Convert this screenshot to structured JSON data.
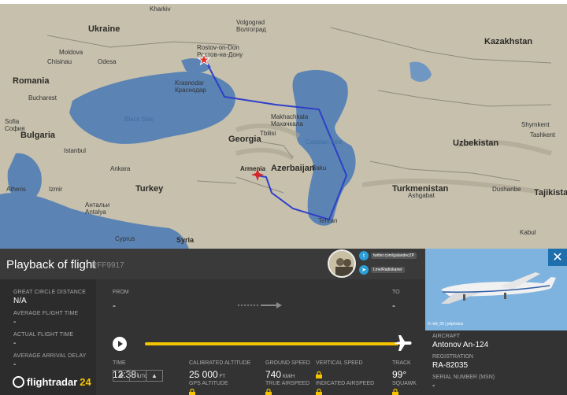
{
  "map": {
    "countries": [
      "Ukraine",
      "Kazakhstan",
      "Romania",
      "Bulgaria",
      "Georgia",
      "Azerbaijan",
      "Armenia",
      "Turkey",
      "Turkmenistan",
      "Uzbekistan",
      "Tajikistan",
      "Syria",
      "Cyprus"
    ],
    "cities": [
      "Kharkiv",
      "Volgograd",
      "Волгоград",
      "Rostov-on-Don",
      "Ростов-на-Дону",
      "Moldova",
      "Chisinau",
      "Odesa",
      "Krasnodar",
      "Краснодар",
      "Bucharest",
      "Sofia",
      "София",
      "Istanbul",
      "Ankara",
      "Izmir",
      "Athens",
      "Антальи",
      "Antalya",
      "Makhachkala",
      "Махачкала",
      "Tbilisi",
      "Baku",
      "Tehran",
      "Ashgabat",
      "Shymkent",
      "Tashkent",
      "Dushanbe",
      "Kabul"
    ],
    "seas": [
      "Black Sea",
      "Caspian Sea"
    ]
  },
  "playback": {
    "title": "Playback of flight",
    "flight_id": "RFF9917"
  },
  "social": {
    "twitter": "twitter.com/galandecZP",
    "telegram": "t.me/Radiokaner"
  },
  "left": {
    "great_circle_label": "GREAT CIRCLE DISTANCE",
    "great_circle_value": "N/A",
    "avg_flight_label": "AVERAGE FLIGHT TIME",
    "avg_flight_value": "-",
    "actual_flight_label": "ACTUAL FLIGHT TIME",
    "actual_flight_value": "-",
    "avg_arrival_label": "AVERAGE ARRIVAL DELAY",
    "avg_arrival_value": "-"
  },
  "route": {
    "from_label": "FROM",
    "from_value": "-",
    "to_label": "TO",
    "to_value": "-"
  },
  "stats": {
    "time_label": "TIME",
    "time_value": "12:38",
    "time_unit": "UTC",
    "cal_alt_label": "CALIBRATED ALTITUDE",
    "cal_alt_value": "25 000",
    "cal_alt_unit": "FT",
    "gps_alt_label": "GPS ALTITUDE",
    "ground_speed_label": "GROUND SPEED",
    "ground_speed_value": "740",
    "ground_speed_unit": "KM/H",
    "true_airspeed_label": "TRUE AIRSPEED",
    "vertical_speed_label": "VERTICAL SPEED",
    "indicated_airspeed_label": "INDICATED AIRSPEED",
    "track_label": "TRACK",
    "track_value": "99°",
    "squawk_label": "SQUAWK"
  },
  "playback_progress": 1.0,
  "logo": {
    "brand": "flightradar",
    "number": "24"
  },
  "aircraft": {
    "credit": "© mill_06 | jetphotos",
    "aircraft_label": "AIRCRAFT",
    "aircraft_value": "Antonov An-124",
    "registration_label": "REGISTRATION",
    "registration_value": "RA-82035",
    "serial_label": "SERIAL NUMBER (MSN)",
    "serial_value": "-"
  },
  "colors": {
    "route_line": "#2f3fc8",
    "slider": "#f5c400",
    "close_button": "#1e6fae",
    "sea": "#5b83b3"
  },
  "icons": [
    "play-icon",
    "plane-icon",
    "close-icon",
    "lock-icon",
    "twitter-icon",
    "telegram-icon",
    "ruler-icon",
    "route-icon",
    "terrain-icon",
    "airport-marker-icon"
  ]
}
